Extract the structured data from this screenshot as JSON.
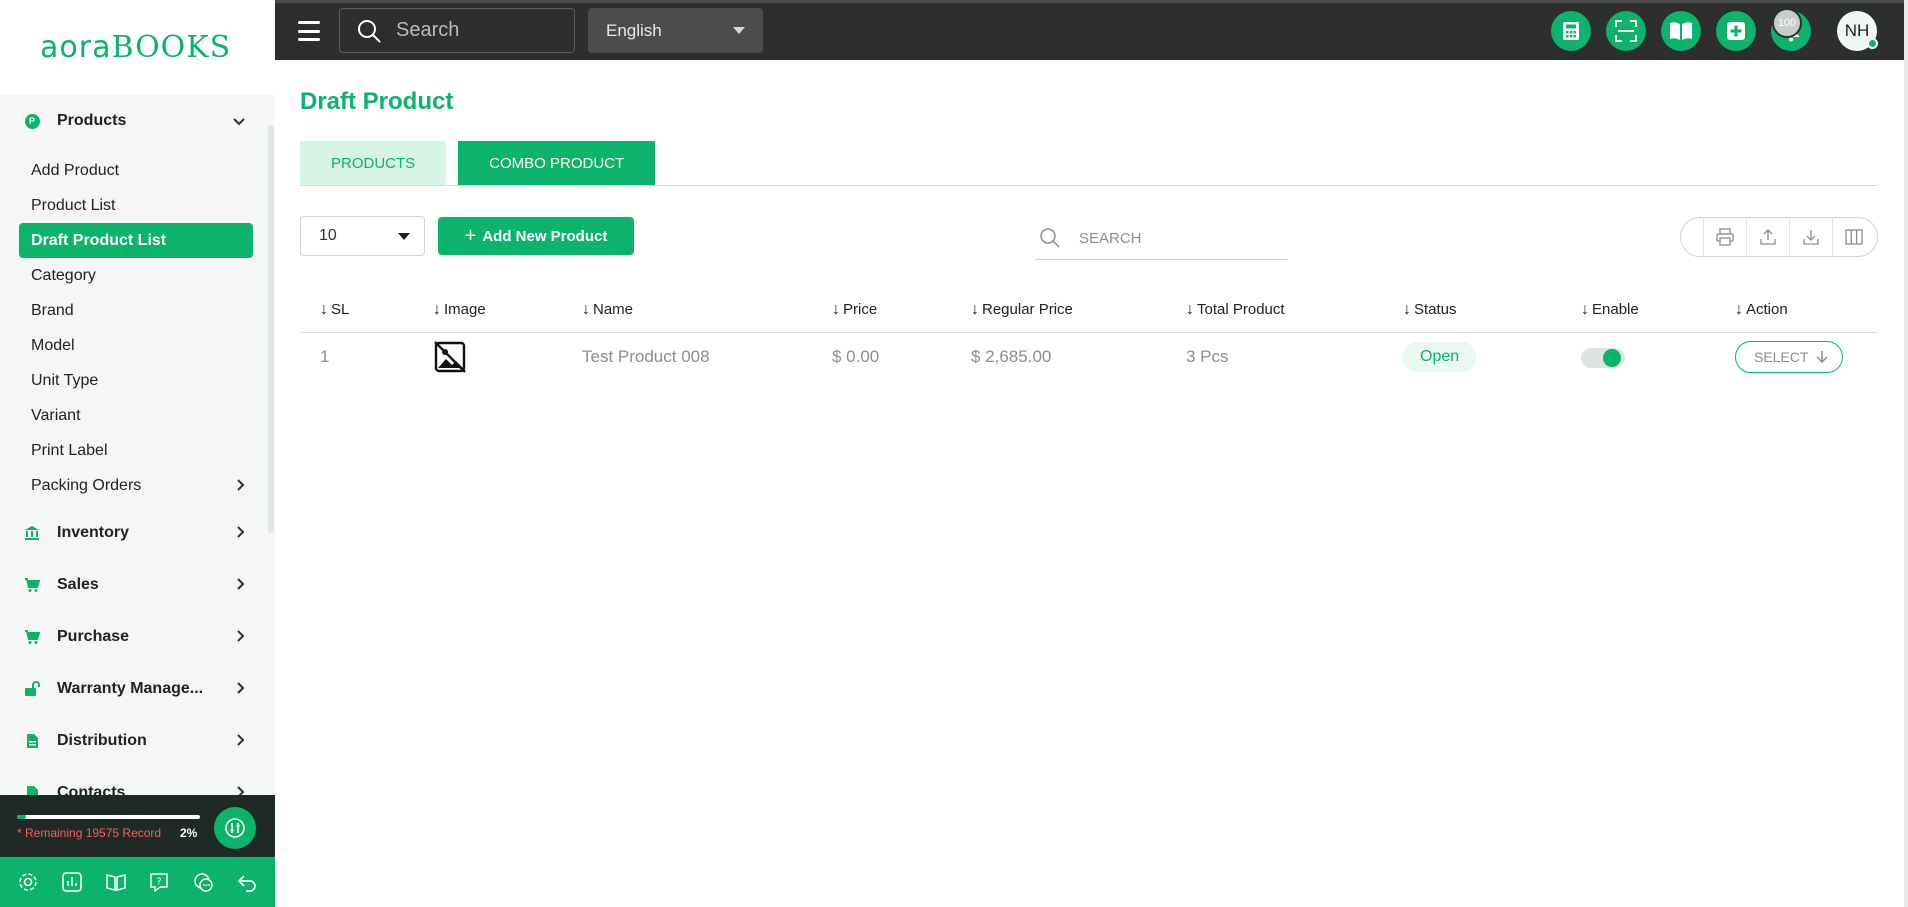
{
  "brand": {
    "logo_prefix": "aora",
    "logo_suffix": "BOOKS"
  },
  "topbar": {
    "search_placeholder": "Search",
    "language": "English",
    "notification_count": "100",
    "avatar_initials": "NH",
    "icons": [
      "calculator-icon",
      "barcode-scan-icon",
      "book-icon",
      "add-box-icon",
      "bell-icon"
    ]
  },
  "sidebar": {
    "groups": [
      {
        "label": "Products",
        "icon": "p-badge-icon"
      },
      {
        "label": "Inventory",
        "icon": "bank-icon"
      },
      {
        "label": "Sales",
        "icon": "cart-icon"
      },
      {
        "label": "Purchase",
        "icon": "cart-icon"
      },
      {
        "label": "Warranty Manage...",
        "icon": "unlock-icon"
      },
      {
        "label": "Distribution",
        "icon": "document-icon"
      },
      {
        "label": "Contacts",
        "icon": "document-icon"
      }
    ],
    "product_items": [
      {
        "label": "Add Product"
      },
      {
        "label": "Product List"
      },
      {
        "label": "Draft Product List",
        "active": true
      },
      {
        "label": "Category"
      },
      {
        "label": "Brand"
      },
      {
        "label": "Model"
      },
      {
        "label": "Unit Type"
      },
      {
        "label": "Variant"
      },
      {
        "label": "Print Label"
      },
      {
        "label": "Packing Orders"
      }
    ],
    "progress": {
      "text": "* Remaining 19575 Record",
      "percent_label": "2%",
      "fraction": 0.02
    },
    "bottom_tools": [
      "settings-icon",
      "chart-icon",
      "book-open-icon",
      "help-icon",
      "chat-icon",
      "undo-icon"
    ]
  },
  "main": {
    "title": "Draft Product",
    "tabs": [
      {
        "label": "PRODUCTS",
        "active": false
      },
      {
        "label": "COMBO PRODUCT",
        "active": true
      }
    ],
    "per_page": "10",
    "add_button": "Add New Product",
    "search_placeholder": "SEARCH",
    "table_tools": [
      "print-icon",
      "upload-icon",
      "download-icon",
      "columns-icon"
    ],
    "columns": [
      "SL",
      "Image",
      "Name",
      "Price",
      "Regular Price",
      "Total Product",
      "Status",
      "Enable",
      "Action"
    ],
    "rows": [
      {
        "sl": "1",
        "name": "Test Product 008",
        "price": "$ 0.00",
        "regular_price": "$ 2,685.00",
        "total_product": "3 Pcs",
        "status": "Open",
        "enabled": true,
        "action": "SELECT"
      }
    ]
  },
  "colors": {
    "accent": "#0bb36b",
    "topbar": "#2c2f2e",
    "danger_text": "#ff5b5b"
  }
}
